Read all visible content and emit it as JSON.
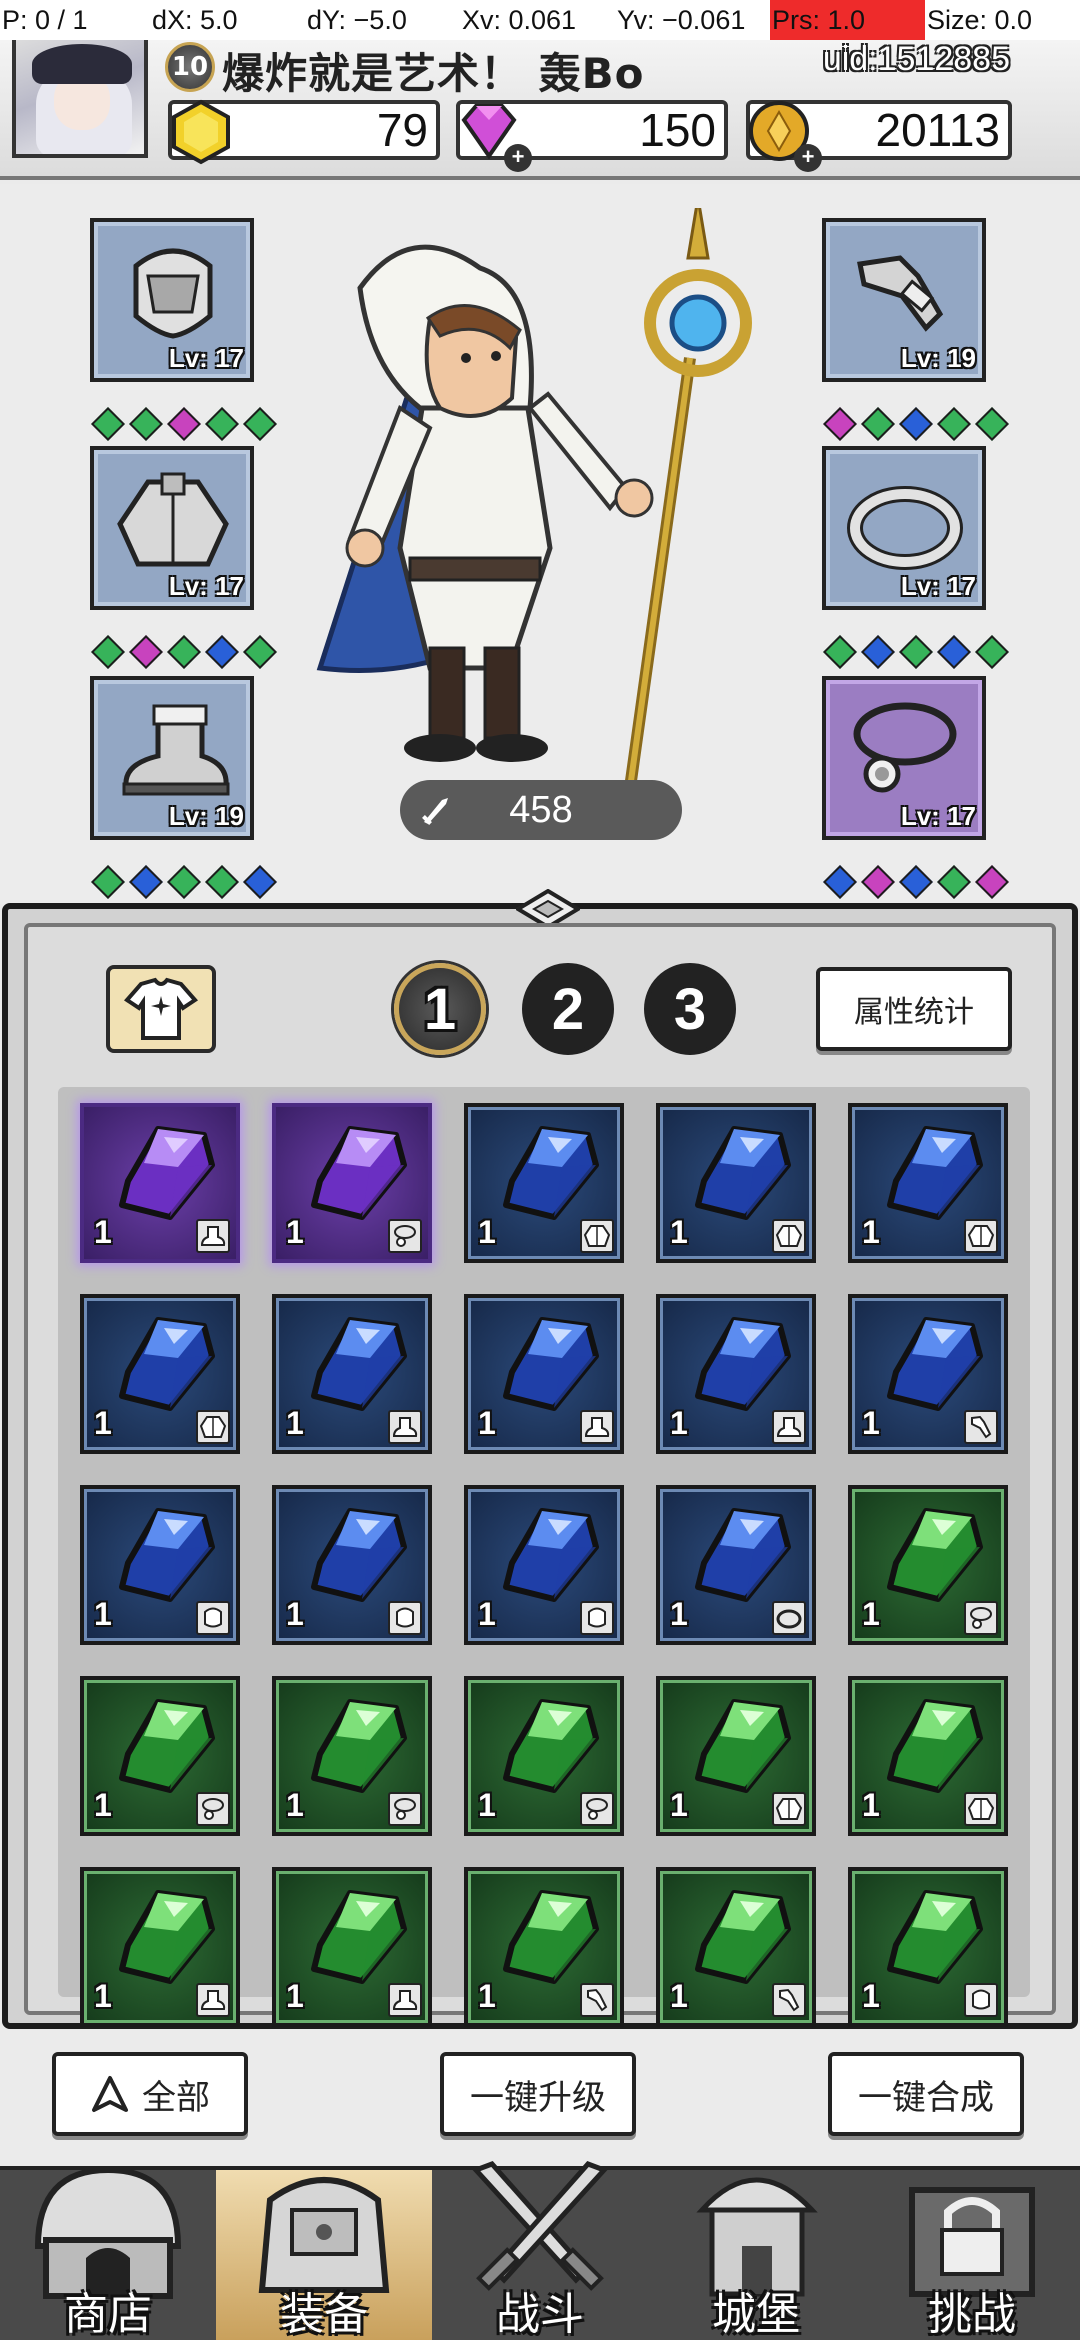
{
  "debug": {
    "p": "P: 0 / 1",
    "dx": "dX: 5.0",
    "dy": "dY: −5.0",
    "xv": "Xv: 0.061",
    "yv": "Yv: −0.061",
    "prs": "Prs: 1.0",
    "size": "Size: 0.0"
  },
  "player": {
    "level": "10",
    "name": "爆炸就是艺术！ 轰Bo",
    "uid": "uid:1512885"
  },
  "currencies": {
    "gold": "79",
    "gem": "150",
    "coin": "20113"
  },
  "equipment": {
    "left": [
      {
        "item": "helmet",
        "level": "Lv: 17",
        "gems": [
          "green",
          "green",
          "pink",
          "green",
          "green"
        ]
      },
      {
        "item": "armor",
        "level": "Lv: 17",
        "gems": [
          "green",
          "pink",
          "green",
          "blue",
          "green"
        ]
      },
      {
        "item": "boots",
        "level": "Lv: 19",
        "gems": [
          "green",
          "blue",
          "green",
          "green",
          "blue"
        ]
      }
    ],
    "right": [
      {
        "item": "bracer",
        "level": "Lv: 19",
        "gems": [
          "pink",
          "green",
          "blue",
          "green",
          "green"
        ]
      },
      {
        "item": "ring",
        "level": "Lv: 17",
        "gems": [
          "green",
          "blue",
          "green",
          "blue",
          "green"
        ]
      },
      {
        "item": "necklace",
        "level": "Lv: 17",
        "gems": [
          "blue",
          "pink",
          "blue",
          "green",
          "pink"
        ]
      }
    ]
  },
  "power": "458",
  "bag": {
    "tabs": [
      "1",
      "2",
      "3"
    ],
    "active_tab": "1",
    "stats_label": "属性统计",
    "gems": [
      {
        "color": "purple",
        "count": "1",
        "slot": "boots"
      },
      {
        "color": "purple",
        "count": "1",
        "slot": "necklace"
      },
      {
        "color": "blue",
        "count": "1",
        "slot": "armor"
      },
      {
        "color": "blue",
        "count": "1",
        "slot": "armor"
      },
      {
        "color": "blue",
        "count": "1",
        "slot": "armor"
      },
      {
        "color": "blue",
        "count": "1",
        "slot": "armor"
      },
      {
        "color": "blue",
        "count": "1",
        "slot": "boots"
      },
      {
        "color": "blue",
        "count": "1",
        "slot": "boots"
      },
      {
        "color": "blue",
        "count": "1",
        "slot": "boots"
      },
      {
        "color": "blue",
        "count": "1",
        "slot": "bracer"
      },
      {
        "color": "blue",
        "count": "1",
        "slot": "helmet"
      },
      {
        "color": "blue",
        "count": "1",
        "slot": "helmet"
      },
      {
        "color": "blue",
        "count": "1",
        "slot": "helmet"
      },
      {
        "color": "blue",
        "count": "1",
        "slot": "ring"
      },
      {
        "color": "green",
        "count": "1",
        "slot": "necklace"
      },
      {
        "color": "green",
        "count": "1",
        "slot": "necklace"
      },
      {
        "color": "green",
        "count": "1",
        "slot": "necklace"
      },
      {
        "color": "green",
        "count": "1",
        "slot": "necklace"
      },
      {
        "color": "green",
        "count": "1",
        "slot": "armor"
      },
      {
        "color": "green",
        "count": "1",
        "slot": "armor"
      },
      {
        "color": "green",
        "count": "1",
        "slot": "boots"
      },
      {
        "color": "green",
        "count": "1",
        "slot": "boots"
      },
      {
        "color": "green",
        "count": "1",
        "slot": "bracer"
      },
      {
        "color": "green",
        "count": "1",
        "slot": "bracer"
      },
      {
        "color": "green",
        "count": "1",
        "slot": "helmet"
      }
    ]
  },
  "actions": {
    "all": "全部",
    "upgrade": "一键升级",
    "merge": "一键合成"
  },
  "nav": [
    {
      "label": "商店",
      "icon": "shop-icon"
    },
    {
      "label": "装备",
      "icon": "equipment-bag-icon",
      "active": true
    },
    {
      "label": "战斗",
      "icon": "crossed-swords-icon"
    },
    {
      "label": "城堡",
      "icon": "castle-icon"
    },
    {
      "label": "挑战",
      "icon": "challenge-lock-icon"
    }
  ]
}
